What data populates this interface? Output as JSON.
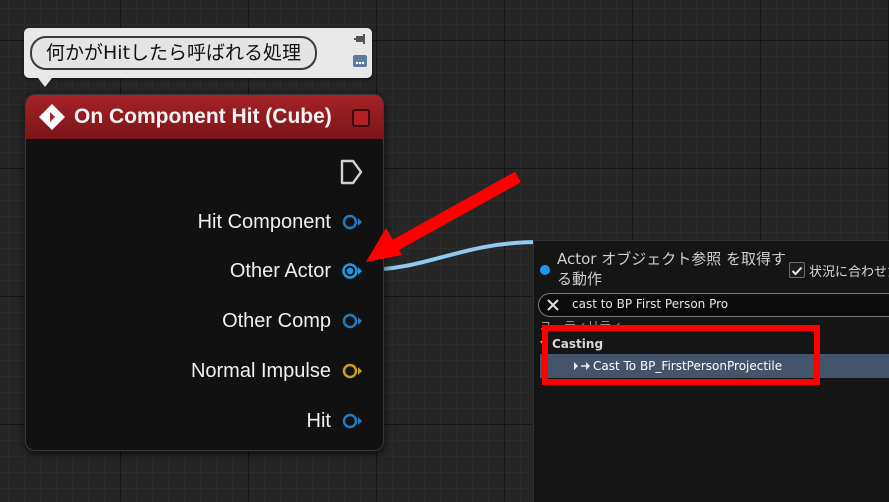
{
  "comment": {
    "text": "何かがHitしたら呼ばれる処理",
    "pin_icon": "pin-icon",
    "menu_icon": "comment-menu-icon"
  },
  "node": {
    "title": "On Component Hit (Cube)",
    "title_icon": "event-diamond-icon",
    "header_color": "#a62327",
    "delegate_icon": "delegate-square-icon",
    "exec_icon": "exec-pin-icon",
    "pins": [
      {
        "label": "Hit Component",
        "color": "#1e7bbf",
        "connected": false
      },
      {
        "label": "Other Actor",
        "color": "#1e9be8",
        "connected": true
      },
      {
        "label": "Other Comp",
        "color": "#1e7bbf",
        "connected": false
      },
      {
        "label": "Normal Impulse",
        "color": "#c9a018",
        "connected": false
      },
      {
        "label": "Hit",
        "color": "#1e7bbf",
        "connected": false
      }
    ]
  },
  "wire": {
    "color": "#8fcaf0"
  },
  "action_menu": {
    "title": "Actor オブジェクト参照 を取得する動作",
    "context_sensitive_label": "状況に合わせた",
    "context_sensitive_checked": true,
    "search_value": "cast to BP First Person Pro",
    "clear_icon": "close-icon",
    "category_utility": "ユーティリティ",
    "category_casting": "Casting",
    "result_label": "Cast To BP_FirstPersonProjectile",
    "result_icon": "cast-node-icon",
    "accent_color": "#1c9be8"
  },
  "annotations": {
    "arrow_color": "#ff0000",
    "highlight_color": "#ff0000"
  }
}
